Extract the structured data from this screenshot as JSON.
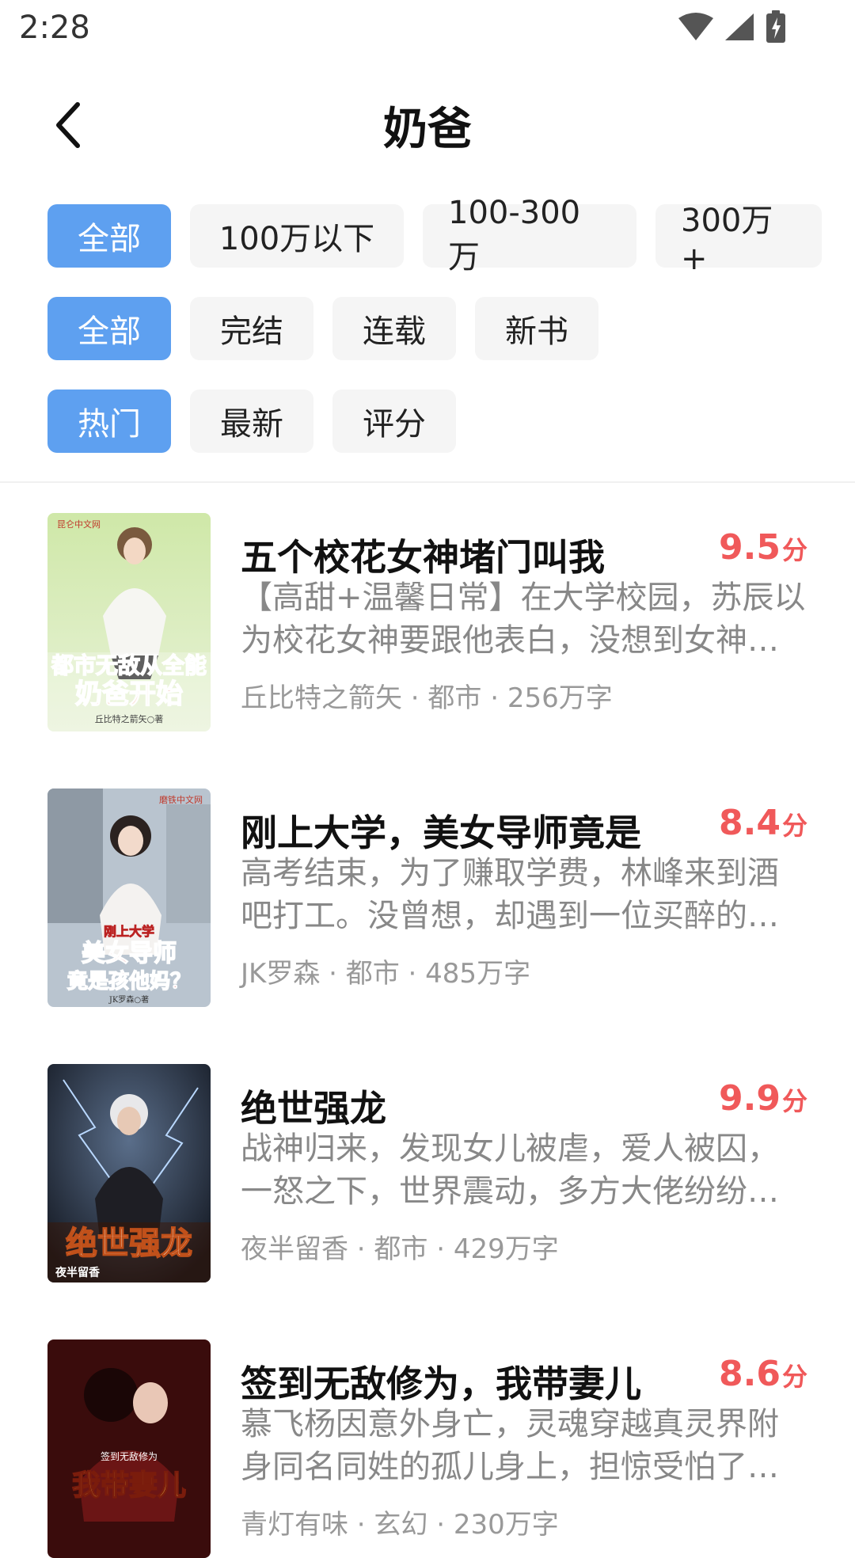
{
  "status_bar": {
    "time": "2:28"
  },
  "header": {
    "title": "奶爸"
  },
  "filters": {
    "word_count": [
      "全部",
      "100万以下",
      "100-300万",
      "300万+"
    ],
    "status": [
      "全部",
      "完结",
      "连载",
      "新书"
    ],
    "sort": [
      "热门",
      "最新",
      "评分"
    ],
    "active_color": "#5ea0f0"
  },
  "books": [
    {
      "title": "五个校花女神堵门叫我",
      "score": "9.5",
      "score_unit": "分",
      "desc": "【高甜+温馨日常】在大学校园，苏辰以为校花女神要跟他表白，没想到女神却是来找女儿的",
      "meta": "丘比特之箭矢 · 都市 · 256万字",
      "cover": {
        "publisher": "昆仑中文网",
        "line1": "都市无敌从全能",
        "line2": "奶爸开始",
        "author": "丘比特之箭矢○著"
      }
    },
    {
      "title": "刚上大学，美女导师竟是",
      "score": "8.4",
      "score_unit": "分",
      "desc": "高考结束，为了赚取学费，林峰来到酒吧打工。没曾想，却遇到一位买醉的美女",
      "meta": "JK罗森 · 都市 · 485万字",
      "cover": {
        "publisher": "磨铁中文网",
        "line1": "刚上大学",
        "line2": "美女导师",
        "line3": "竟是孩他妈？",
        "author": "JK罗森○著"
      }
    },
    {
      "title": "绝世强龙",
      "score": "9.9",
      "score_unit": "分",
      "desc": "战神归来，发现女儿被虐，爱人被囚，一怒之下，世界震动，多方大佬纷纷前来",
      "meta": "夜半留香 · 都市 · 429万字",
      "cover": {
        "line1": "绝世强龙",
        "author": "夜半留香"
      }
    },
    {
      "title": "签到无敌修为，我带妻儿",
      "score": "8.6",
      "score_unit": "分",
      "desc": "慕飞杨因意外身亡，灵魂穿越真灵界附身同名同姓的孤儿身上，担惊受怕了十几年",
      "meta": "青灯有味 · 玄幻 · 230万字",
      "cover": {
        "line0": "签到无敌修为",
        "line1": "我带妻儿"
      }
    }
  ]
}
